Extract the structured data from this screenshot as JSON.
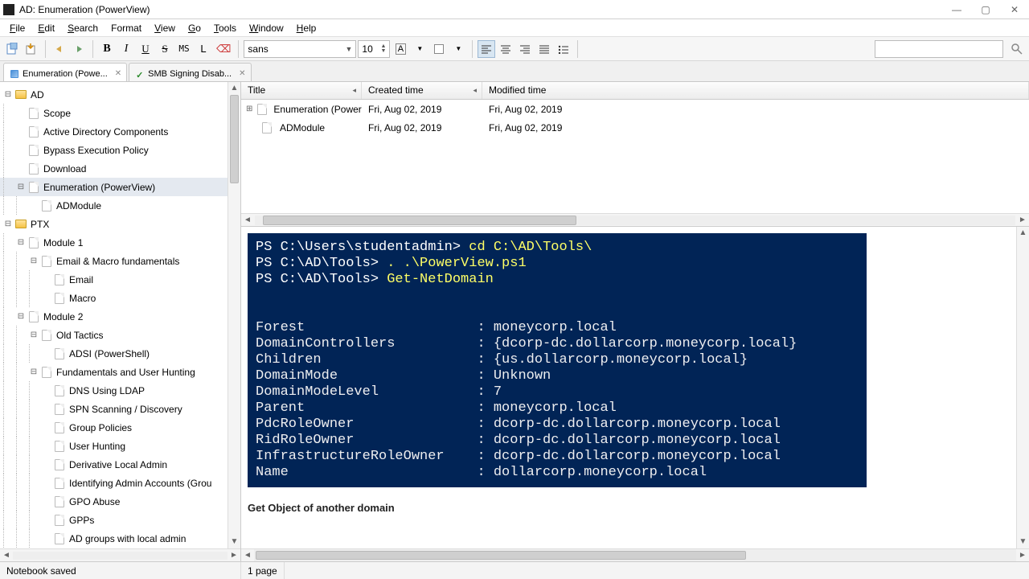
{
  "window": {
    "title": "AD: Enumeration (PowerView)"
  },
  "menu": {
    "file": "File",
    "edit": "Edit",
    "search": "Search",
    "format": "Format",
    "view": "View",
    "go": "Go",
    "tools": "Tools",
    "window": "Window",
    "help": "Help"
  },
  "toolbar": {
    "font_name": "sans",
    "font_size": "10"
  },
  "tabs": [
    {
      "label": "Enumeration (Powe...",
      "icon": "edit",
      "active": true
    },
    {
      "label": "SMB Signing Disab...",
      "icon": "check",
      "active": false
    }
  ],
  "tree": {
    "items": [
      {
        "depth": 0,
        "twister": "-",
        "icon": "folder",
        "label": "AD"
      },
      {
        "depth": 1,
        "twister": "",
        "icon": "page",
        "label": "Scope"
      },
      {
        "depth": 1,
        "twister": "",
        "icon": "page",
        "label": "Active Directory Components"
      },
      {
        "depth": 1,
        "twister": "",
        "icon": "page",
        "label": "Bypass Execution Policy"
      },
      {
        "depth": 1,
        "twister": "",
        "icon": "page",
        "label": "Download"
      },
      {
        "depth": 1,
        "twister": "-",
        "icon": "page",
        "label": "Enumeration (PowerView)",
        "selected": true
      },
      {
        "depth": 2,
        "twister": "",
        "icon": "page",
        "label": "ADModule"
      },
      {
        "depth": 0,
        "twister": "-",
        "icon": "folder",
        "label": "PTX"
      },
      {
        "depth": 1,
        "twister": "-",
        "icon": "page",
        "label": "Module 1"
      },
      {
        "depth": 2,
        "twister": "-",
        "icon": "page",
        "label": "Email & Macro fundamentals"
      },
      {
        "depth": 3,
        "twister": "",
        "icon": "page",
        "label": "Email"
      },
      {
        "depth": 3,
        "twister": "",
        "icon": "page",
        "label": "Macro"
      },
      {
        "depth": 1,
        "twister": "-",
        "icon": "page",
        "label": "Module 2"
      },
      {
        "depth": 2,
        "twister": "-",
        "icon": "page",
        "label": "Old Tactics"
      },
      {
        "depth": 3,
        "twister": "",
        "icon": "page",
        "label": "ADSI (PowerShell)"
      },
      {
        "depth": 2,
        "twister": "-",
        "icon": "page",
        "label": "Fundamentals and User Hunting"
      },
      {
        "depth": 3,
        "twister": "",
        "icon": "page",
        "label": "DNS Using LDAP"
      },
      {
        "depth": 3,
        "twister": "",
        "icon": "page",
        "label": "SPN Scanning / Discovery"
      },
      {
        "depth": 3,
        "twister": "",
        "icon": "page",
        "label": "Group Policies"
      },
      {
        "depth": 3,
        "twister": "",
        "icon": "page",
        "label": "User Hunting"
      },
      {
        "depth": 3,
        "twister": "",
        "icon": "page",
        "label": "Derivative Local Admin"
      },
      {
        "depth": 3,
        "twister": "",
        "icon": "page",
        "label": "Identifying Admin Accounts (Grou"
      },
      {
        "depth": 3,
        "twister": "",
        "icon": "page",
        "label": "GPO Abuse"
      },
      {
        "depth": 3,
        "twister": "",
        "icon": "page",
        "label": "GPPs"
      },
      {
        "depth": 3,
        "twister": "",
        "icon": "page",
        "label": "AD groups with local admin"
      }
    ]
  },
  "list": {
    "columns": {
      "title": "Title",
      "created": "Created time",
      "modified": "Modified time"
    },
    "rows": [
      {
        "title": "Enumeration (PowerView)",
        "created": "Fri, Aug 02, 2019",
        "modified": "Fri, Aug 02, 2019",
        "expandable": true
      },
      {
        "title": "ADModule",
        "created": "Fri, Aug 02, 2019",
        "modified": "Fri, Aug 02, 2019",
        "expandable": false
      }
    ]
  },
  "content": {
    "terminal_lines": [
      {
        "prompt": "PS C:\\Users\\studentadmin> ",
        "cmd": "cd C:\\AD\\Tools\\"
      },
      {
        "prompt": "PS C:\\AD\\Tools> ",
        "cmd": ". .\\PowerView.ps1"
      },
      {
        "prompt": "PS C:\\AD\\Tools> ",
        "cmd": "Get-NetDomain"
      }
    ],
    "output": [
      {
        "key": "Forest",
        "value": "moneycorp.local"
      },
      {
        "key": "DomainControllers",
        "value": "{dcorp-dc.dollarcorp.moneycorp.local}"
      },
      {
        "key": "Children",
        "value": "{us.dollarcorp.moneycorp.local}"
      },
      {
        "key": "DomainMode",
        "value": "Unknown"
      },
      {
        "key": "DomainModeLevel",
        "value": "7"
      },
      {
        "key": "Parent",
        "value": "moneycorp.local"
      },
      {
        "key": "PdcRoleOwner",
        "value": "dcorp-dc.dollarcorp.moneycorp.local"
      },
      {
        "key": "RidRoleOwner",
        "value": "dcorp-dc.dollarcorp.moneycorp.local"
      },
      {
        "key": "InfrastructureRoleOwner",
        "value": "dcorp-dc.dollarcorp.moneycorp.local"
      },
      {
        "key": "Name",
        "value": "dollarcorp.moneycorp.local"
      }
    ],
    "caption": "Get Object of another domain"
  },
  "status": {
    "left": "Notebook saved",
    "right": "1 page"
  }
}
